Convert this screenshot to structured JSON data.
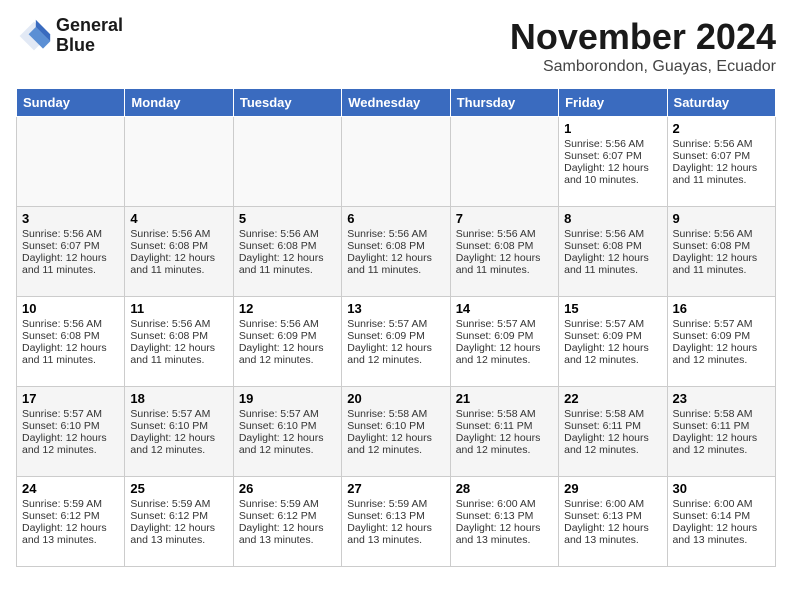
{
  "logo": {
    "line1": "General",
    "line2": "Blue"
  },
  "title": "November 2024",
  "subtitle": "Samborondon, Guayas, Ecuador",
  "days_of_week": [
    "Sunday",
    "Monday",
    "Tuesday",
    "Wednesday",
    "Thursday",
    "Friday",
    "Saturday"
  ],
  "weeks": [
    [
      {
        "day": "",
        "content": ""
      },
      {
        "day": "",
        "content": ""
      },
      {
        "day": "",
        "content": ""
      },
      {
        "day": "",
        "content": ""
      },
      {
        "day": "",
        "content": ""
      },
      {
        "day": "1",
        "content": "Sunrise: 5:56 AM\nSunset: 6:07 PM\nDaylight: 12 hours\nand 10 minutes."
      },
      {
        "day": "2",
        "content": "Sunrise: 5:56 AM\nSunset: 6:07 PM\nDaylight: 12 hours\nand 11 minutes."
      }
    ],
    [
      {
        "day": "3",
        "content": "Sunrise: 5:56 AM\nSunset: 6:07 PM\nDaylight: 12 hours\nand 11 minutes."
      },
      {
        "day": "4",
        "content": "Sunrise: 5:56 AM\nSunset: 6:08 PM\nDaylight: 12 hours\nand 11 minutes."
      },
      {
        "day": "5",
        "content": "Sunrise: 5:56 AM\nSunset: 6:08 PM\nDaylight: 12 hours\nand 11 minutes."
      },
      {
        "day": "6",
        "content": "Sunrise: 5:56 AM\nSunset: 6:08 PM\nDaylight: 12 hours\nand 11 minutes."
      },
      {
        "day": "7",
        "content": "Sunrise: 5:56 AM\nSunset: 6:08 PM\nDaylight: 12 hours\nand 11 minutes."
      },
      {
        "day": "8",
        "content": "Sunrise: 5:56 AM\nSunset: 6:08 PM\nDaylight: 12 hours\nand 11 minutes."
      },
      {
        "day": "9",
        "content": "Sunrise: 5:56 AM\nSunset: 6:08 PM\nDaylight: 12 hours\nand 11 minutes."
      }
    ],
    [
      {
        "day": "10",
        "content": "Sunrise: 5:56 AM\nSunset: 6:08 PM\nDaylight: 12 hours\nand 11 minutes."
      },
      {
        "day": "11",
        "content": "Sunrise: 5:56 AM\nSunset: 6:08 PM\nDaylight: 12 hours\nand 11 minutes."
      },
      {
        "day": "12",
        "content": "Sunrise: 5:56 AM\nSunset: 6:09 PM\nDaylight: 12 hours\nand 12 minutes."
      },
      {
        "day": "13",
        "content": "Sunrise: 5:57 AM\nSunset: 6:09 PM\nDaylight: 12 hours\nand 12 minutes."
      },
      {
        "day": "14",
        "content": "Sunrise: 5:57 AM\nSunset: 6:09 PM\nDaylight: 12 hours\nand 12 minutes."
      },
      {
        "day": "15",
        "content": "Sunrise: 5:57 AM\nSunset: 6:09 PM\nDaylight: 12 hours\nand 12 minutes."
      },
      {
        "day": "16",
        "content": "Sunrise: 5:57 AM\nSunset: 6:09 PM\nDaylight: 12 hours\nand 12 minutes."
      }
    ],
    [
      {
        "day": "17",
        "content": "Sunrise: 5:57 AM\nSunset: 6:10 PM\nDaylight: 12 hours\nand 12 minutes."
      },
      {
        "day": "18",
        "content": "Sunrise: 5:57 AM\nSunset: 6:10 PM\nDaylight: 12 hours\nand 12 minutes."
      },
      {
        "day": "19",
        "content": "Sunrise: 5:57 AM\nSunset: 6:10 PM\nDaylight: 12 hours\nand 12 minutes."
      },
      {
        "day": "20",
        "content": "Sunrise: 5:58 AM\nSunset: 6:10 PM\nDaylight: 12 hours\nand 12 minutes."
      },
      {
        "day": "21",
        "content": "Sunrise: 5:58 AM\nSunset: 6:11 PM\nDaylight: 12 hours\nand 12 minutes."
      },
      {
        "day": "22",
        "content": "Sunrise: 5:58 AM\nSunset: 6:11 PM\nDaylight: 12 hours\nand 12 minutes."
      },
      {
        "day": "23",
        "content": "Sunrise: 5:58 AM\nSunset: 6:11 PM\nDaylight: 12 hours\nand 12 minutes."
      }
    ],
    [
      {
        "day": "24",
        "content": "Sunrise: 5:59 AM\nSunset: 6:12 PM\nDaylight: 12 hours\nand 13 minutes."
      },
      {
        "day": "25",
        "content": "Sunrise: 5:59 AM\nSunset: 6:12 PM\nDaylight: 12 hours\nand 13 minutes."
      },
      {
        "day": "26",
        "content": "Sunrise: 5:59 AM\nSunset: 6:12 PM\nDaylight: 12 hours\nand 13 minutes."
      },
      {
        "day": "27",
        "content": "Sunrise: 5:59 AM\nSunset: 6:13 PM\nDaylight: 12 hours\nand 13 minutes."
      },
      {
        "day": "28",
        "content": "Sunrise: 6:00 AM\nSunset: 6:13 PM\nDaylight: 12 hours\nand 13 minutes."
      },
      {
        "day": "29",
        "content": "Sunrise: 6:00 AM\nSunset: 6:13 PM\nDaylight: 12 hours\nand 13 minutes."
      },
      {
        "day": "30",
        "content": "Sunrise: 6:00 AM\nSunset: 6:14 PM\nDaylight: 12 hours\nand 13 minutes."
      }
    ]
  ]
}
